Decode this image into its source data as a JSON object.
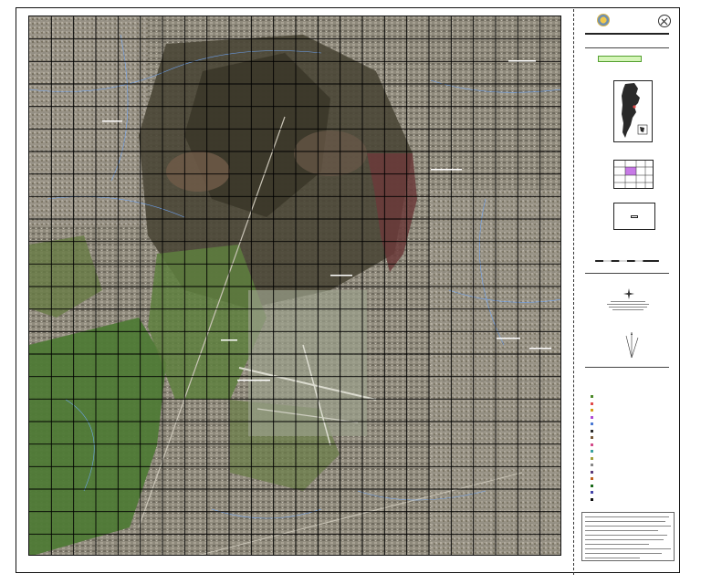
{
  "map": {
    "footer_text": "",
    "grid_cols": 24,
    "grid_rows": 24,
    "top_ticks": [
      "",
      "",
      "",
      "",
      "",
      "",
      "",
      "",
      "",
      "",
      "",
      ""
    ],
    "left_ticks": [
      "",
      "",
      "",
      "",
      "",
      "",
      "",
      "",
      "",
      "",
      "",
      ""
    ]
  },
  "legend_panel": {
    "header": {
      "org_line1": "",
      "org_line2": "",
      "org_line3": ""
    },
    "title_lines": [
      "",
      "",
      ""
    ],
    "sheet_badge": "",
    "location_caption": "",
    "index_caption": "",
    "scale_caption": "",
    "declination_caption": "",
    "legend_title": "",
    "legend_items": [
      {
        "label": "",
        "color": "#4d8a2a"
      },
      {
        "label": "",
        "color": "#e24b4b"
      },
      {
        "label": "",
        "color": "#d4a017"
      },
      {
        "label": "",
        "color": "#b04bd4"
      },
      {
        "label": "",
        "color": "#4b7ad4"
      },
      {
        "label": "",
        "color": "#2a2a2a"
      },
      {
        "label": "",
        "color": "#7a5a3a"
      },
      {
        "label": "",
        "color": "#d44b8a"
      },
      {
        "label": "",
        "color": "#3aa0a0"
      },
      {
        "label": "",
        "color": "#a0a03a"
      },
      {
        "label": "",
        "color": "#888888"
      },
      {
        "label": "",
        "color": "#5a3a7a"
      },
      {
        "label": "",
        "color": "#c06020"
      },
      {
        "label": "",
        "color": "#1a6a1a"
      },
      {
        "label": "",
        "color": "#4444aa"
      },
      {
        "label": "",
        "color": "#111111"
      }
    ]
  },
  "colors": {
    "grid": "#000000",
    "roads": "#6fa8ff",
    "urban": "#8f8a7c",
    "field_green": "#4f7a36",
    "field_dark": "#3e3b2e",
    "river_brown": "#6b3a3a",
    "badge_green": "#d5f5b8",
    "index_highlight": "#c77ae6"
  }
}
